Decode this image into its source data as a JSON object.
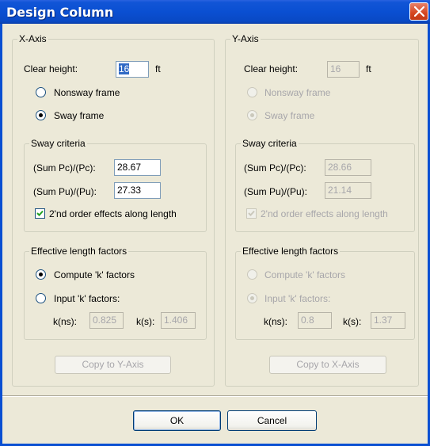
{
  "window": {
    "title": "Design Column"
  },
  "x_axis": {
    "group_label": "X-Axis",
    "clear_height_label": "Clear height:",
    "clear_height_value": "16",
    "clear_height_unit": "ft",
    "nonsway_label": "Nonsway frame",
    "sway_label": "Sway frame",
    "frame_selected": "sway",
    "sway_criteria_label": "Sway criteria",
    "sum_pc_label": "(Sum Pc)/(Pc):",
    "sum_pc_value": "28.67",
    "sum_pu_label": "(Sum Pu)/(Pu):",
    "sum_pu_value": "27.33",
    "second_order_label": "2'nd order effects along length",
    "second_order_checked": true,
    "elf_label": "Effective length factors",
    "compute_k_label": "Compute 'k' factors",
    "input_k_label": "Input 'k' factors:",
    "k_selected": "compute",
    "kns_label": "k(ns):",
    "kns_value": "0.825",
    "ks_label": "k(s):",
    "ks_value": "1.406",
    "copy_button": "Copy to Y-Axis"
  },
  "y_axis": {
    "group_label": "Y-Axis",
    "clear_height_label": "Clear height:",
    "clear_height_value": "16",
    "clear_height_unit": "ft",
    "nonsway_label": "Nonsway frame",
    "sway_label": "Sway frame",
    "frame_selected": "sway",
    "sway_criteria_label": "Sway criteria",
    "sum_pc_label": "(Sum Pc)/(Pc):",
    "sum_pc_value": "28.66",
    "sum_pu_label": "(Sum Pu)/(Pu):",
    "sum_pu_value": "21.14",
    "second_order_label": "2'nd order effects along length",
    "second_order_checked": true,
    "elf_label": "Effective length factors",
    "compute_k_label": "Compute 'k' factors",
    "input_k_label": "Input 'k' factors:",
    "k_selected": "input",
    "kns_label": "k(ns):",
    "kns_value": "0.8",
    "ks_label": "k(s):",
    "ks_value": "1.37",
    "copy_button": "Copy to X-Axis"
  },
  "buttons": {
    "ok": "OK",
    "cancel": "Cancel"
  }
}
